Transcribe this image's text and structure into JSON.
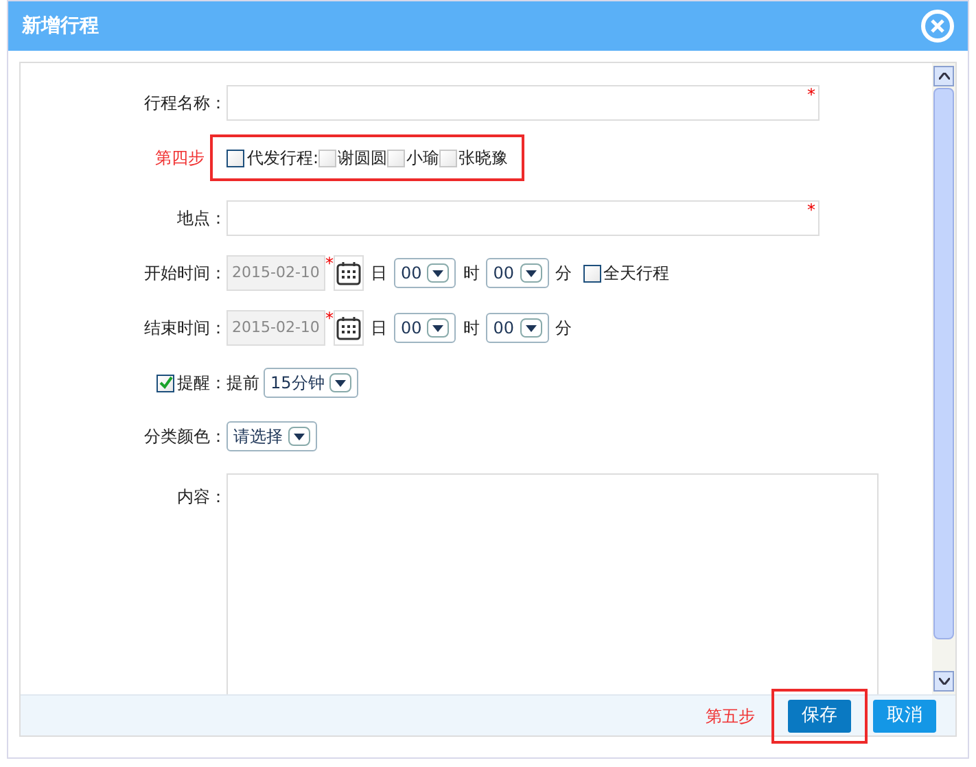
{
  "window": {
    "title": "新增行程"
  },
  "name_field": {
    "label": "行程名称：",
    "required_mark": "*"
  },
  "step4": {
    "label": "第四步"
  },
  "delegate": {
    "label": "代发行程:",
    "checked": false,
    "people": [
      {
        "name": "谢圆圆",
        "checked": false
      },
      {
        "name": "小瑜",
        "checked": false
      },
      {
        "name": "张晓豫",
        "checked": false
      }
    ]
  },
  "location": {
    "label": "地点：",
    "required_mark": "*"
  },
  "start": {
    "label": "开始时间：",
    "date": "2015-02-10",
    "required_mark": "*",
    "day": "日",
    "hour": "00",
    "hour_unit": "时",
    "minute": "00",
    "minute_unit": "分",
    "all_day": {
      "label": "全天行程",
      "checked": false
    }
  },
  "end": {
    "label": "结束时间：",
    "date": "2015-02-10",
    "required_mark": "*",
    "day": "日",
    "hour": "00",
    "hour_unit": "时",
    "minute": "00",
    "minute_unit": "分"
  },
  "reminder": {
    "label": "提醒：",
    "checked": true,
    "prefix": "提前",
    "value": "15分钟"
  },
  "category": {
    "label": "分类颜色：",
    "value": "请选择"
  },
  "content": {
    "label": "内容："
  },
  "footer": {
    "step": "第五步",
    "buttons": [
      {
        "label": "保存",
        "kind": "primary"
      },
      {
        "label": "取消",
        "kind": "secondary"
      }
    ]
  }
}
